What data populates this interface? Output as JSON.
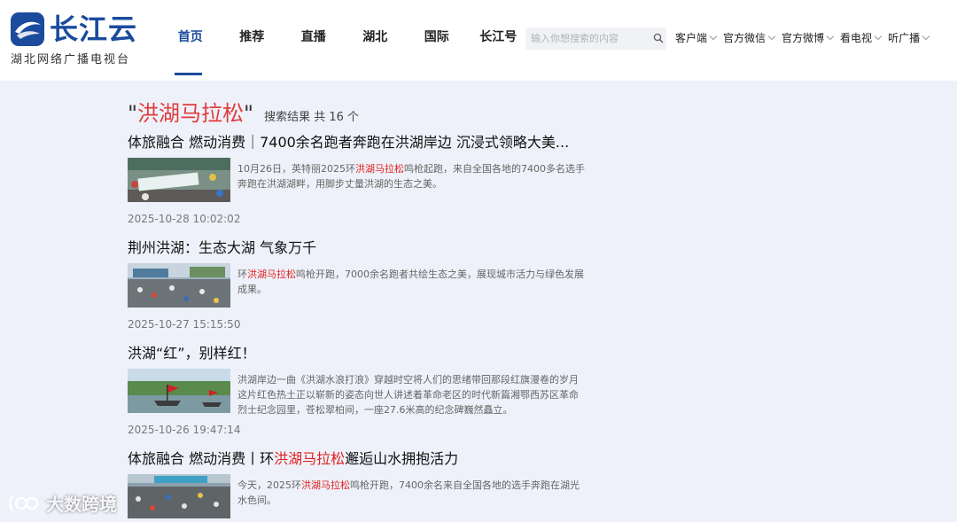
{
  "brand": {
    "name": "长江云",
    "subtitle": "湖北网络广播电视台",
    "color": "#1b4b9c"
  },
  "nav": [
    {
      "label": "首页",
      "active": true
    },
    {
      "label": "推荐"
    },
    {
      "label": "直播"
    },
    {
      "label": "湖北"
    },
    {
      "label": "国际"
    },
    {
      "label": "长江号"
    }
  ],
  "search": {
    "placeholder": "输入你想搜索的内容",
    "icon": "search-icon"
  },
  "header_links": [
    "客户端",
    "官方微信",
    "官方微博",
    "看电视",
    "听广播"
  ],
  "results_header": {
    "keyword": "洪湖马拉松",
    "open_quote": "\"",
    "close_quote": "\"",
    "count_text": "搜索结果 共 16 个"
  },
  "results": [
    {
      "title_pre": "体旅融合 燃动消费｜7400余名跑者奔跑在洪湖岸边 沉浸式领略大美...",
      "title_hl": "",
      "title_post": "",
      "summary_pre": "10月26日，英特丽2025环",
      "summary_hl": "洪湖马拉松",
      "summary_post": "鸣枪起跑，来自全国各地的7400多名选手奔跑在洪湖湖畔，用脚步丈量洪湖的生态之美。",
      "thumb_text": "奔跑洪湖 燃动全城",
      "date": "2025-10-28 10:02:02"
    },
    {
      "title_pre": "荆州洪湖：生态大湖 气象万千",
      "title_hl": "",
      "title_post": "",
      "summary_pre": "环",
      "summary_hl": "洪湖马拉松",
      "summary_post": "鸣枪开跑，7000余名跑者共绘生态之美，展现城市活力与绿色发展成果。",
      "thumb_text": "",
      "date": "2025-10-27 15:15:50"
    },
    {
      "title_pre": "洪湖“红”，别样红！",
      "title_hl": "",
      "title_post": "",
      "summary_pre": "洪湖岸边一曲《洪湖水浪打浪》穿越时空将人们的思绪带回那段红旗漫卷的岁月这片红色热土正以崭新的姿态向世人讲述着革命老区的时代新篇湘鄂西苏区革命烈士纪念园里，苍松翠柏间，一座27.6米高的纪念碑巍然矗立。",
      "summary_hl": "",
      "summary_post": "",
      "thumb_text": "",
      "date": "2025-10-26 19:47:14"
    },
    {
      "title_pre": "体旅融合 燃动消费丨环",
      "title_hl": "洪湖马拉松",
      "title_post": "邂逅山水拥抱活力",
      "summary_pre": "今天，2025环",
      "summary_hl": "洪湖马拉松",
      "summary_post": "鸣枪开跑，7400余名来自全国各地的选手奔跑在湖光水色间。",
      "thumb_text": "",
      "date": ""
    }
  ],
  "watermark": {
    "text": "大数跨境"
  }
}
